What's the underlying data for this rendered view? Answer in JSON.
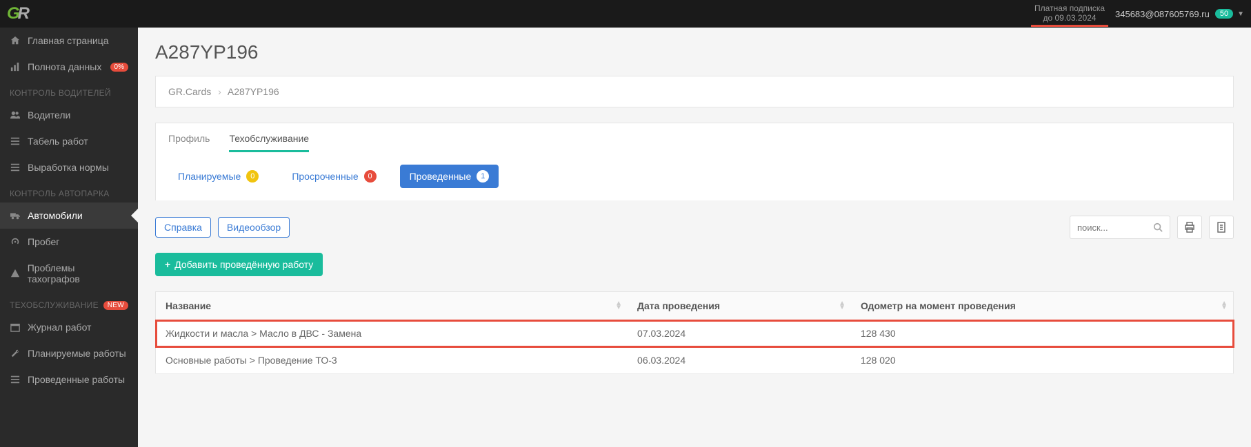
{
  "header": {
    "subscription_line1": "Платная подписка",
    "subscription_line2": "до 09.03.2024",
    "user_email": "345683@087605769.ru",
    "user_badge": "50"
  },
  "sidebar": {
    "items": {
      "home": "Главная страница",
      "data": "Полнота данных",
      "data_pct": "0%",
      "drivers": "Водители",
      "timesheet": "Табель работ",
      "production": "Выработка нормы",
      "vehicles": "Автомобили",
      "mileage": "Пробег",
      "tacho": "Проблемы тахографов",
      "worklog": "Журнал работ",
      "planned": "Планируемые работы",
      "done": "Проведенные работы"
    },
    "sections": {
      "drivers_ctrl": "КОНТРОЛЬ ВОДИТЕЛЕЙ",
      "fleet_ctrl": "КОНТРОЛЬ АВТОПАРКА",
      "maint": "ТЕХОБСЛУЖИВАНИЕ"
    },
    "new_badge": "NEW"
  },
  "page": {
    "title": "A287YP196",
    "breadcrumb_root": "GR.Cards",
    "breadcrumb_current": "A287YP196"
  },
  "tabs": {
    "profile": "Профиль",
    "maintenance": "Техобслуживание"
  },
  "filters": {
    "planned_label": "Планируемые",
    "planned_count": "0",
    "overdue_label": "Просроченные",
    "overdue_count": "0",
    "done_label": "Проведенные",
    "done_count": "1"
  },
  "toolbar": {
    "help": "Справка",
    "video": "Видеообзор",
    "search_placeholder": "поиск...",
    "add_label": "Добавить проведённую работу"
  },
  "table": {
    "col_name": "Название",
    "col_date": "Дата проведения",
    "col_odo": "Одометр на момент проведения",
    "rows": [
      {
        "name": "Жидкости и масла > Масло в ДВС - Замена",
        "date": "07.03.2024",
        "odo": "128 430"
      },
      {
        "name": "Основные работы > Проведение ТО-3",
        "date": "06.03.2024",
        "odo": "128 020"
      }
    ]
  }
}
